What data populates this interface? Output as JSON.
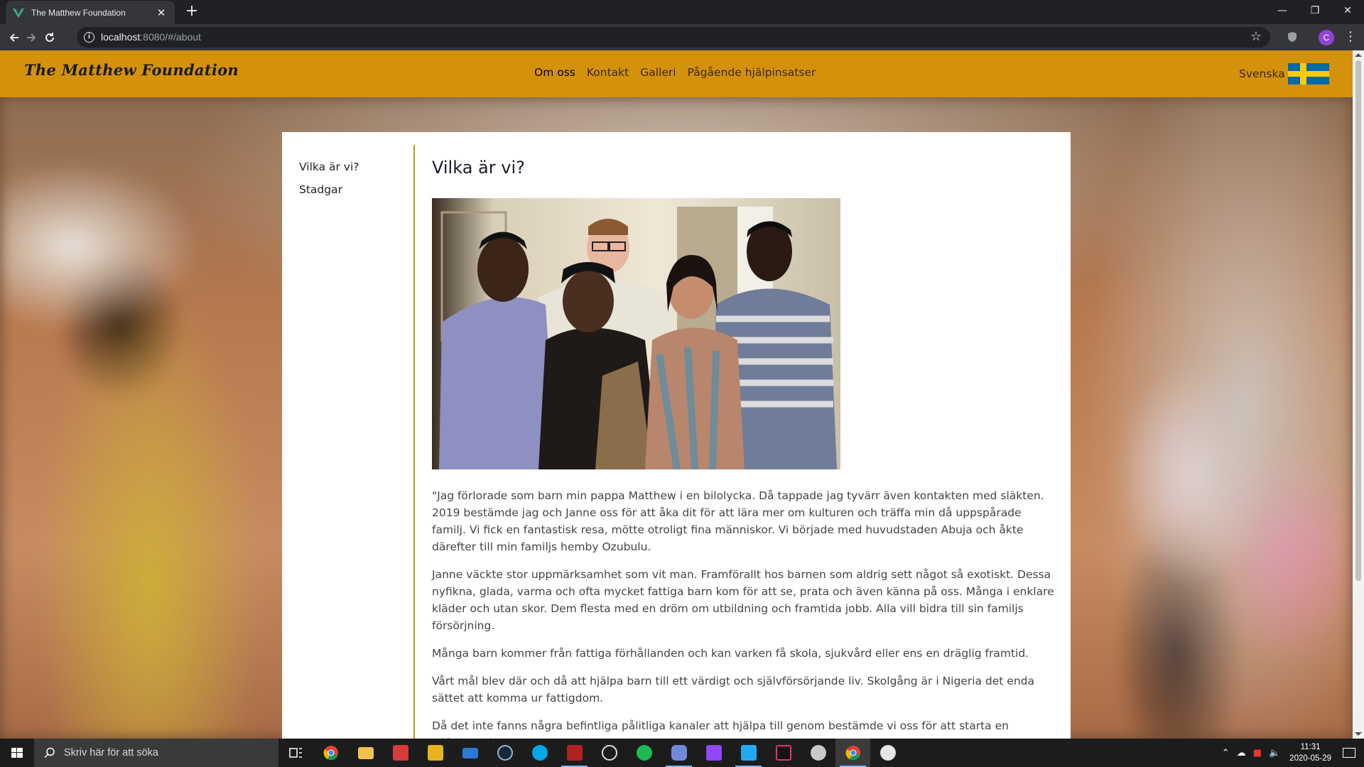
{
  "browser": {
    "tab_title": "The Matthew Foundation",
    "tab_close": "✕",
    "new_tab": "+",
    "url_host": "localhost",
    "url_path": ":8080/#/about",
    "window_controls": {
      "minimize": "—",
      "restore": "❐",
      "close": "✕"
    },
    "profile_initial": "C"
  },
  "site": {
    "brand": "The Matthew Foundation",
    "nav": [
      "Om oss",
      "Kontakt",
      "Galleri",
      "Pågående hjälpinsatser"
    ],
    "active_nav": "Om oss",
    "language": "Svenska",
    "accent_color": "#d4910c"
  },
  "sidebar": {
    "items": [
      "Vilka är vi?",
      "Stadgar"
    ]
  },
  "article": {
    "title": "Vilka är vi?",
    "paragraphs": [
      "\"Jag förlorade som barn min pappa Matthew i en bilolycka. Då tappade jag tyvärr även kontakten med släkten. 2019 bestämde jag och Janne oss för att åka dit för att lära mer om kulturen och träffa min då uppspårade familj. Vi fick en fantastisk resa, mötte otroligt fina människor. Vi började med huvudstaden Abuja och åkte därefter till min familjs hemby Ozubulu.",
      "Janne väckte stor uppmärksamhet som vit man. Framförallt hos barnen som aldrig sett något så exotiskt. Dessa nyfikna, glada, varma och ofta mycket fattiga barn kom för att se, prata och även känna på oss. Många i enklare kläder och utan skor. Dem flesta med en dröm om utbildning och framtida jobb. Alla vill bidra till sin familjs försörjning.",
      "Många barn kommer från fattiga förhållanden och kan varken få skola, sjukvård eller ens en dräglig framtid.",
      "Vårt mål blev där och då att hjälpa barn till ett värdigt och självförsörjande liv. Skolgång är i Nigeria det enda sättet att komma ur fattigdom.",
      "Då det inte fanns några befintliga pålitliga kanaler att hjälpa till genom bestämde vi oss för att starta en stiftelse. The"
    ]
  },
  "taskbar": {
    "search_placeholder": "Skriv här för att söka",
    "apps": [
      "task-view",
      "chrome",
      "file-explorer",
      "gift",
      "store",
      "mail",
      "steam",
      "skype",
      "settings-gear",
      "speedometer",
      "spotify",
      "discord",
      "twitch",
      "vscode",
      "intellij",
      "bird-app",
      "chrome-active",
      "paint"
    ],
    "time": "11:31",
    "date": "2020-05-29"
  }
}
